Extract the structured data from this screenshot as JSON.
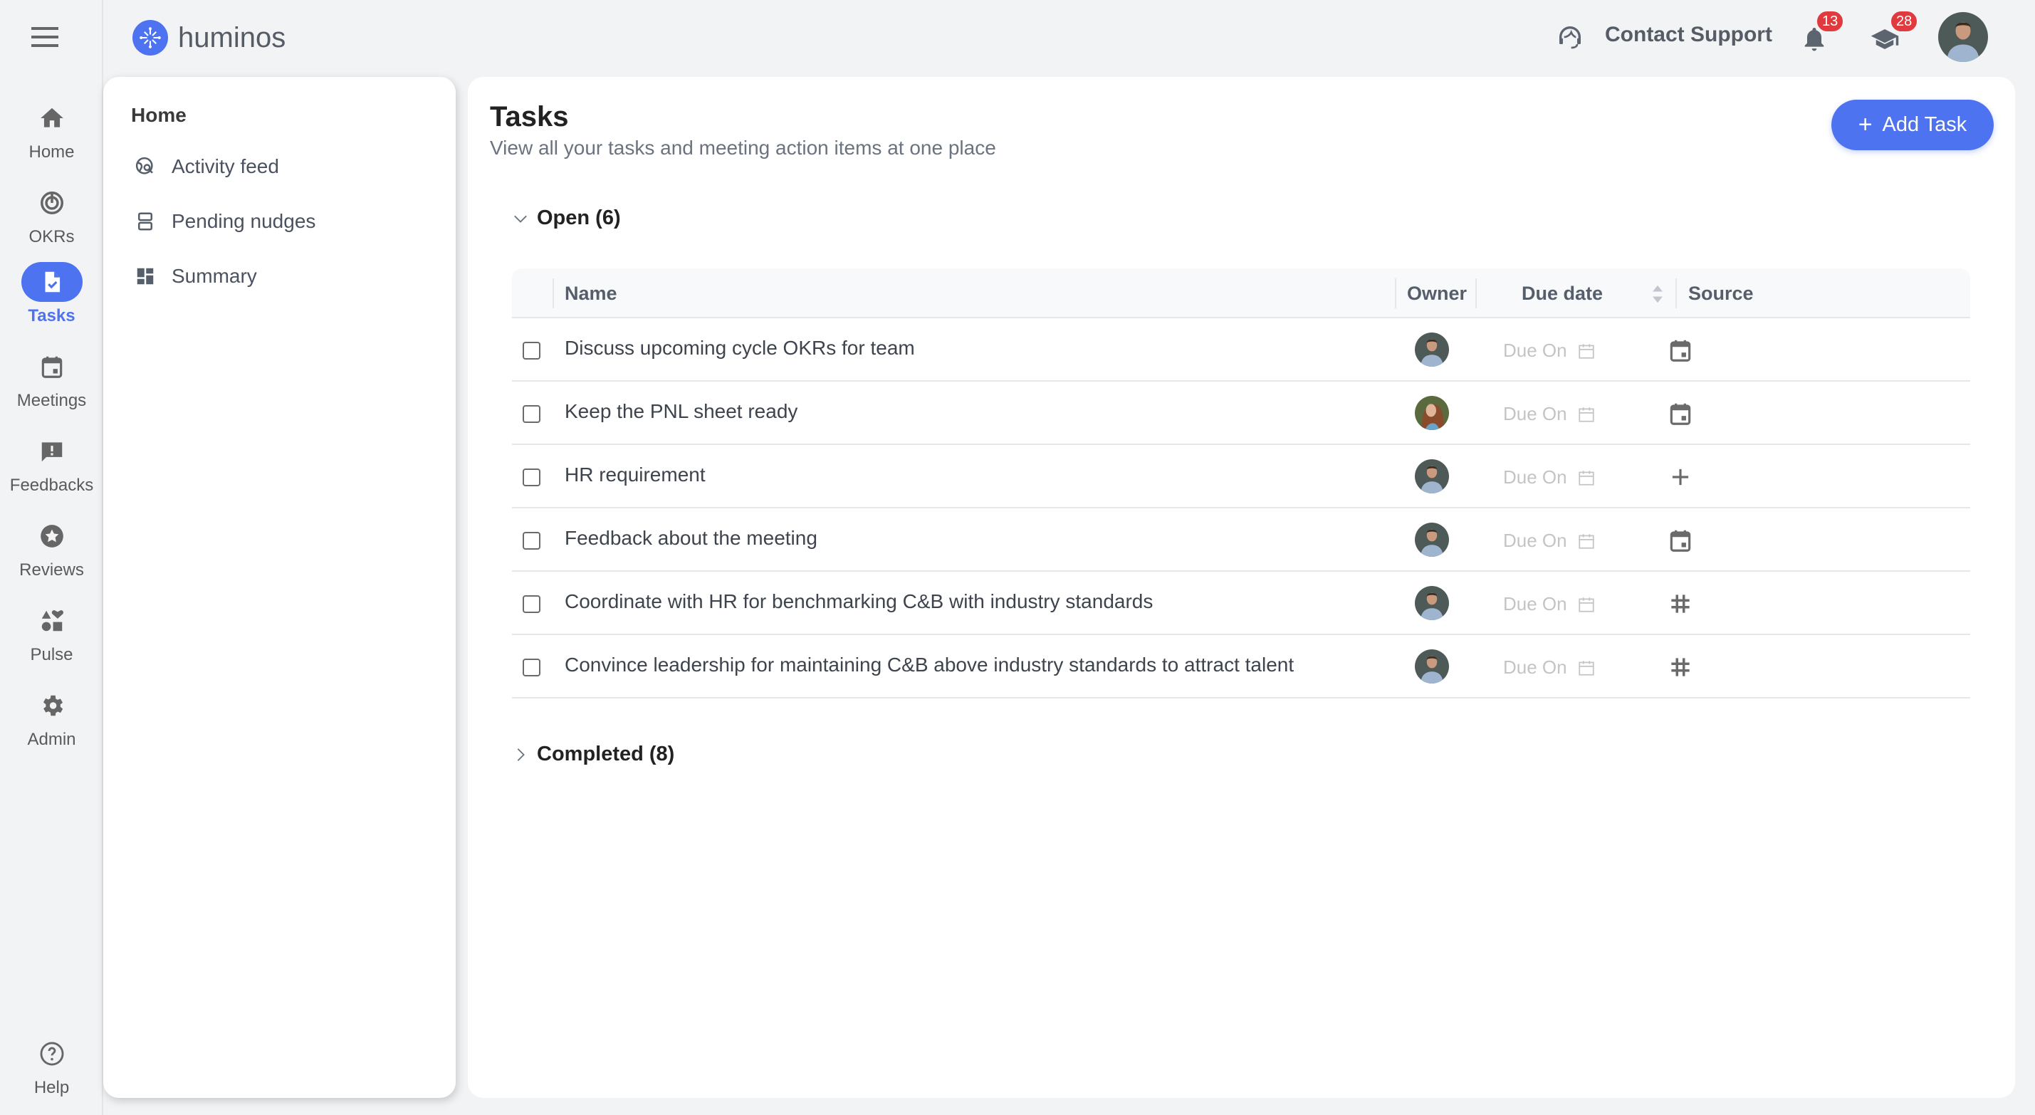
{
  "app": {
    "name": "huminos"
  },
  "rail": {
    "menu_icon": "hamburger-icon",
    "items": [
      {
        "label": "Home",
        "icon": "home-icon",
        "active": false
      },
      {
        "label": "OKRs",
        "icon": "target-icon",
        "active": false
      },
      {
        "label": "Tasks",
        "icon": "task-file-icon",
        "active": true
      },
      {
        "label": "Meetings",
        "icon": "calendar-icon",
        "active": false
      },
      {
        "label": "Feedbacks",
        "icon": "feedback-icon",
        "active": false
      },
      {
        "label": "Reviews",
        "icon": "star-icon",
        "active": false
      },
      {
        "label": "Pulse",
        "icon": "shapes-icon",
        "active": false
      },
      {
        "label": "Admin",
        "icon": "gear-icon",
        "active": false
      }
    ],
    "help": {
      "label": "Help",
      "icon": "help-icon"
    }
  },
  "header": {
    "support_label": "Contact Support",
    "notifications_count": "13",
    "learning_count": "28"
  },
  "home_panel": {
    "title": "Home",
    "items": [
      {
        "label": "Activity feed",
        "icon": "globe-search-icon"
      },
      {
        "label": "Pending nudges",
        "icon": "stacked-rows-icon"
      },
      {
        "label": "Summary",
        "icon": "dashboard-icon"
      }
    ]
  },
  "main": {
    "title": "Tasks",
    "subtitle": "View all your tasks and meeting action items at one place",
    "add_button": "Add Task",
    "open_section": "Open (6)",
    "completed_section": "Completed (8)",
    "columns": {
      "name": "Name",
      "owner": "Owner",
      "due": "Due date",
      "source": "Source"
    },
    "tasks": [
      {
        "name": "Discuss upcoming cycle OKRs for team",
        "owner": "man",
        "due": "Due On",
        "source": "calendar"
      },
      {
        "name": "Keep the PNL sheet ready",
        "owner": "woman",
        "due": "Due On",
        "source": "calendar"
      },
      {
        "name": "HR requirement",
        "owner": "man",
        "due": "Due On",
        "source": "plus"
      },
      {
        "name": "Feedback about the meeting",
        "owner": "man",
        "due": "Due On",
        "source": "calendar"
      },
      {
        "name": "Coordinate with HR for benchmarking C&B with industry standards",
        "owner": "man",
        "due": "Due On",
        "source": "hash"
      },
      {
        "name": "Convince leadership for maintaining C&B above industry standards to attract talent",
        "owner": "man",
        "due": "Due On",
        "source": "hash"
      }
    ]
  },
  "colors": {
    "accent": "#4e73f0",
    "badge": "#e0393e",
    "background": "#f2f3f5"
  }
}
